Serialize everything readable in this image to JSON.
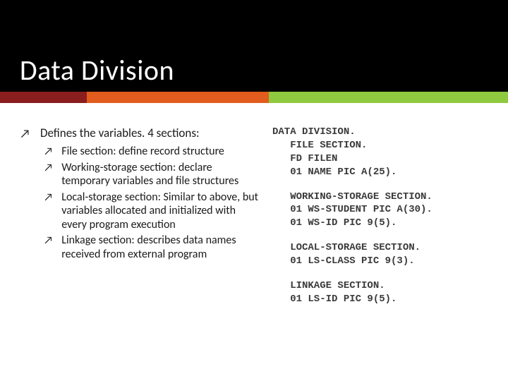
{
  "header": {
    "title": "Data Division"
  },
  "left": {
    "intro": "Defines the variables.  4 sections:",
    "items": [
      "File section: define record structure",
      "Working-storage section: declare temporary variables and file structures",
      "Local-storage section: Similar to above, but variables allocated and initialized with every program execution",
      "Linkage section: describes data names received from external program"
    ]
  },
  "code": {
    "block1": "DATA DIVISION.\n   FILE SECTION.\n   FD FILEN\n   01 NAME PIC A(25).",
    "block2": "   WORKING-STORAGE SECTION.\n   01 WS-STUDENT PIC A(30).\n   01 WS-ID PIC 9(5).",
    "block3": "   LOCAL-STORAGE SECTION.\n   01 LS-CLASS PIC 9(3).",
    "block4": "   LINKAGE SECTION.\n   01 LS-ID PIC 9(5)."
  },
  "bullets": {
    "arrow": "↗"
  }
}
